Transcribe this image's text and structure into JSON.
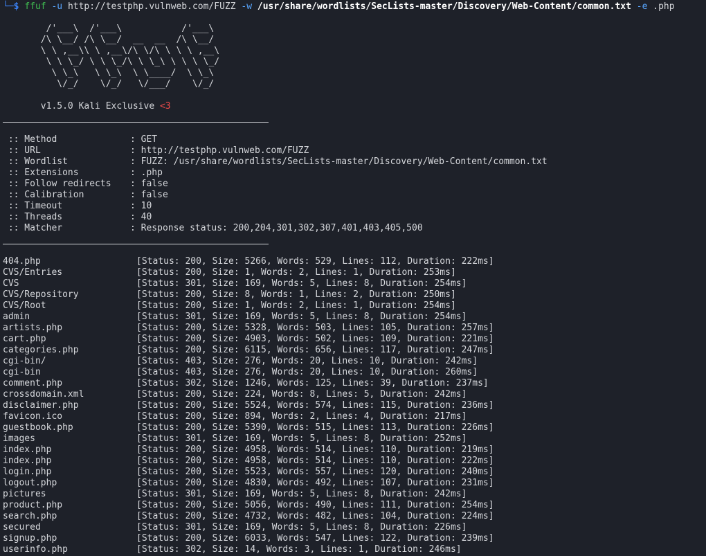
{
  "command": {
    "prompt_corner": "└─",
    "prompt_dollar": "$",
    "program": "ffuf",
    "flag_u": "-u",
    "url": "http://testphp.vulnweb.com/FUZZ",
    "flag_w": "-w",
    "wordlist": "/usr/share/wordlists/SecLists-master/Discovery/Web-Content/common.txt",
    "flag_e": "-e",
    "extension": ".php"
  },
  "banner": {
    "art": [
      "        /'___\\  /'___\\           /'___\\",
      "       /\\ \\__/ /\\ \\__/  __  __  /\\ \\__/",
      "       \\ \\ ,__\\\\ \\ ,__\\/\\ \\/\\ \\ \\ \\ ,__\\",
      "        \\ \\ \\_/ \\ \\ \\_/\\ \\ \\_\\ \\ \\ \\ \\_/",
      "         \\ \\_\\   \\ \\_\\  \\ \\____/  \\ \\_\\",
      "          \\/_/    \\/_/   \\/___/    \\/_/"
    ],
    "version": "       v1.5.0 Kali Exclusive ",
    "heart": "<3"
  },
  "config": [
    {
      "key": " :: Method",
      "value": ": GET"
    },
    {
      "key": " :: URL",
      "value": ": http://testphp.vulnweb.com/FUZZ"
    },
    {
      "key": " :: Wordlist",
      "value": ": FUZZ: /usr/share/wordlists/SecLists-master/Discovery/Web-Content/common.txt"
    },
    {
      "key": " :: Extensions",
      "value": ": .php"
    },
    {
      "key": " :: Follow redirects",
      "value": ": false"
    },
    {
      "key": " :: Calibration",
      "value": ": false"
    },
    {
      "key": " :: Timeout",
      "value": ": 10"
    },
    {
      "key": " :: Threads",
      "value": ": 40"
    },
    {
      "key": " :: Matcher",
      "value": ": Response status: 200,204,301,302,307,401,403,405,500"
    }
  ],
  "results": [
    {
      "path": "404.php",
      "info": "[Status: 200, Size: 5266, Words: 529, Lines: 112, Duration: 222ms]"
    },
    {
      "path": "CVS/Entries",
      "info": "[Status: 200, Size: 1, Words: 2, Lines: 1, Duration: 253ms]"
    },
    {
      "path": "CVS",
      "info": "[Status: 301, Size: 169, Words: 5, Lines: 8, Duration: 254ms]"
    },
    {
      "path": "CVS/Repository",
      "info": "[Status: 200, Size: 8, Words: 1, Lines: 2, Duration: 250ms]"
    },
    {
      "path": "CVS/Root",
      "info": "[Status: 200, Size: 1, Words: 2, Lines: 1, Duration: 254ms]"
    },
    {
      "path": "admin",
      "info": "[Status: 301, Size: 169, Words: 5, Lines: 8, Duration: 254ms]"
    },
    {
      "path": "artists.php",
      "info": "[Status: 200, Size: 5328, Words: 503, Lines: 105, Duration: 257ms]"
    },
    {
      "path": "cart.php",
      "info": "[Status: 200, Size: 4903, Words: 502, Lines: 109, Duration: 221ms]"
    },
    {
      "path": "categories.php",
      "info": "[Status: 200, Size: 6115, Words: 656, Lines: 117, Duration: 247ms]"
    },
    {
      "path": "cgi-bin/",
      "info": "[Status: 403, Size: 276, Words: 20, Lines: 10, Duration: 242ms]"
    },
    {
      "path": "cgi-bin",
      "info": "[Status: 403, Size: 276, Words: 20, Lines: 10, Duration: 260ms]"
    },
    {
      "path": "comment.php",
      "info": "[Status: 302, Size: 1246, Words: 125, Lines: 39, Duration: 237ms]"
    },
    {
      "path": "crossdomain.xml",
      "info": "[Status: 200, Size: 224, Words: 8, Lines: 5, Duration: 242ms]"
    },
    {
      "path": "disclaimer.php",
      "info": "[Status: 200, Size: 5524, Words: 574, Lines: 115, Duration: 236ms]"
    },
    {
      "path": "favicon.ico",
      "info": "[Status: 200, Size: 894, Words: 2, Lines: 4, Duration: 217ms]"
    },
    {
      "path": "guestbook.php",
      "info": "[Status: 200, Size: 5390, Words: 515, Lines: 113, Duration: 226ms]"
    },
    {
      "path": "images",
      "info": "[Status: 301, Size: 169, Words: 5, Lines: 8, Duration: 252ms]"
    },
    {
      "path": "index.php",
      "info": "[Status: 200, Size: 4958, Words: 514, Lines: 110, Duration: 219ms]"
    },
    {
      "path": "index.php",
      "info": "[Status: 200, Size: 4958, Words: 514, Lines: 110, Duration: 222ms]"
    },
    {
      "path": "login.php",
      "info": "[Status: 200, Size: 5523, Words: 557, Lines: 120, Duration: 240ms]"
    },
    {
      "path": "logout.php",
      "info": "[Status: 200, Size: 4830, Words: 492, Lines: 107, Duration: 231ms]"
    },
    {
      "path": "pictures",
      "info": "[Status: 301, Size: 169, Words: 5, Lines: 8, Duration: 242ms]"
    },
    {
      "path": "product.php",
      "info": "[Status: 200, Size: 5056, Words: 490, Lines: 111, Duration: 254ms]"
    },
    {
      "path": "search.php",
      "info": "[Status: 200, Size: 4732, Words: 482, Lines: 104, Duration: 224ms]"
    },
    {
      "path": "secured",
      "info": "[Status: 301, Size: 169, Words: 5, Lines: 8, Duration: 226ms]"
    },
    {
      "path": "signup.php",
      "info": "[Status: 200, Size: 6033, Words: 547, Lines: 122, Duration: 239ms]"
    },
    {
      "path": "userinfo.php",
      "info": "[Status: 302, Size: 14, Words: 3, Lines: 1, Duration: 246ms]"
    }
  ],
  "colors": {
    "background": "#1e2129",
    "text": "#d6d8dc",
    "prompt": "#3b82f6",
    "command": "#3fb950",
    "heart": "#f14c4c"
  }
}
